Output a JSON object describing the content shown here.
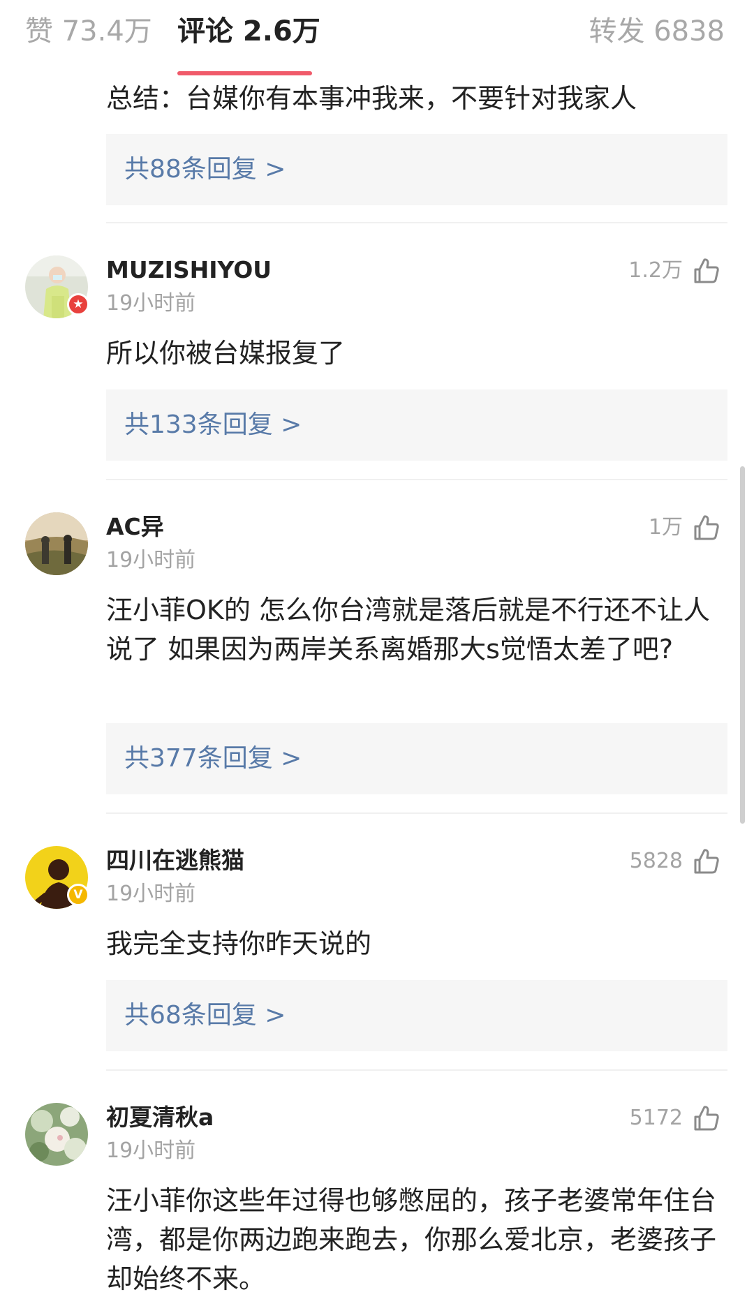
{
  "tabs": {
    "likes": "赞 73.4万",
    "comments": "评论 2.6万",
    "reposts": "转发 6838"
  },
  "comments": [
    {
      "text": "总结：台媒你有本事冲我来，不要针对我家人",
      "reply_link": "共88条回复 >"
    },
    {
      "username": "MUZISHIYOU",
      "time": "19小时前",
      "likes": "1.2万",
      "text": "所以你被台媒报复了",
      "reply_link": "共133条回复 >",
      "badge": "red-star-badge"
    },
    {
      "username": "AC异",
      "time": "19小时前",
      "likes": "1万",
      "text": "汪小菲OK的 怎么你台湾就是落后就是不行还不让人说了 如果因为两岸关系离婚那大s觉悟太差了吧?",
      "reply_link": "共377条回复 >"
    },
    {
      "username": "四川在逃熊猫",
      "time": "19小时前",
      "likes": "5828",
      "text": "我完全支持你昨天说的",
      "reply_link": "共68条回复 >",
      "badge": "yellow-v-badge"
    },
    {
      "username": "初夏清秋a",
      "time": "19小时前",
      "likes": "5172",
      "text": "汪小菲你这些年过得也够憋屈的，孩子老婆常年住台湾，都是你两边跑来跑去，你那么爱北京，老婆孩子却始终不来。"
    }
  ],
  "colors": {
    "tab_underline": "#f05a6a",
    "reply_link": "#587aa8",
    "reply_bg": "#f6f6f6",
    "muted_text": "#a3a3a3",
    "red_badge": "#e8413d",
    "yellow_badge": "#f5b800"
  },
  "icons": {
    "like": "thumbs-up-icon",
    "red_badge_glyph": "★",
    "yellow_badge_glyph": "V"
  }
}
